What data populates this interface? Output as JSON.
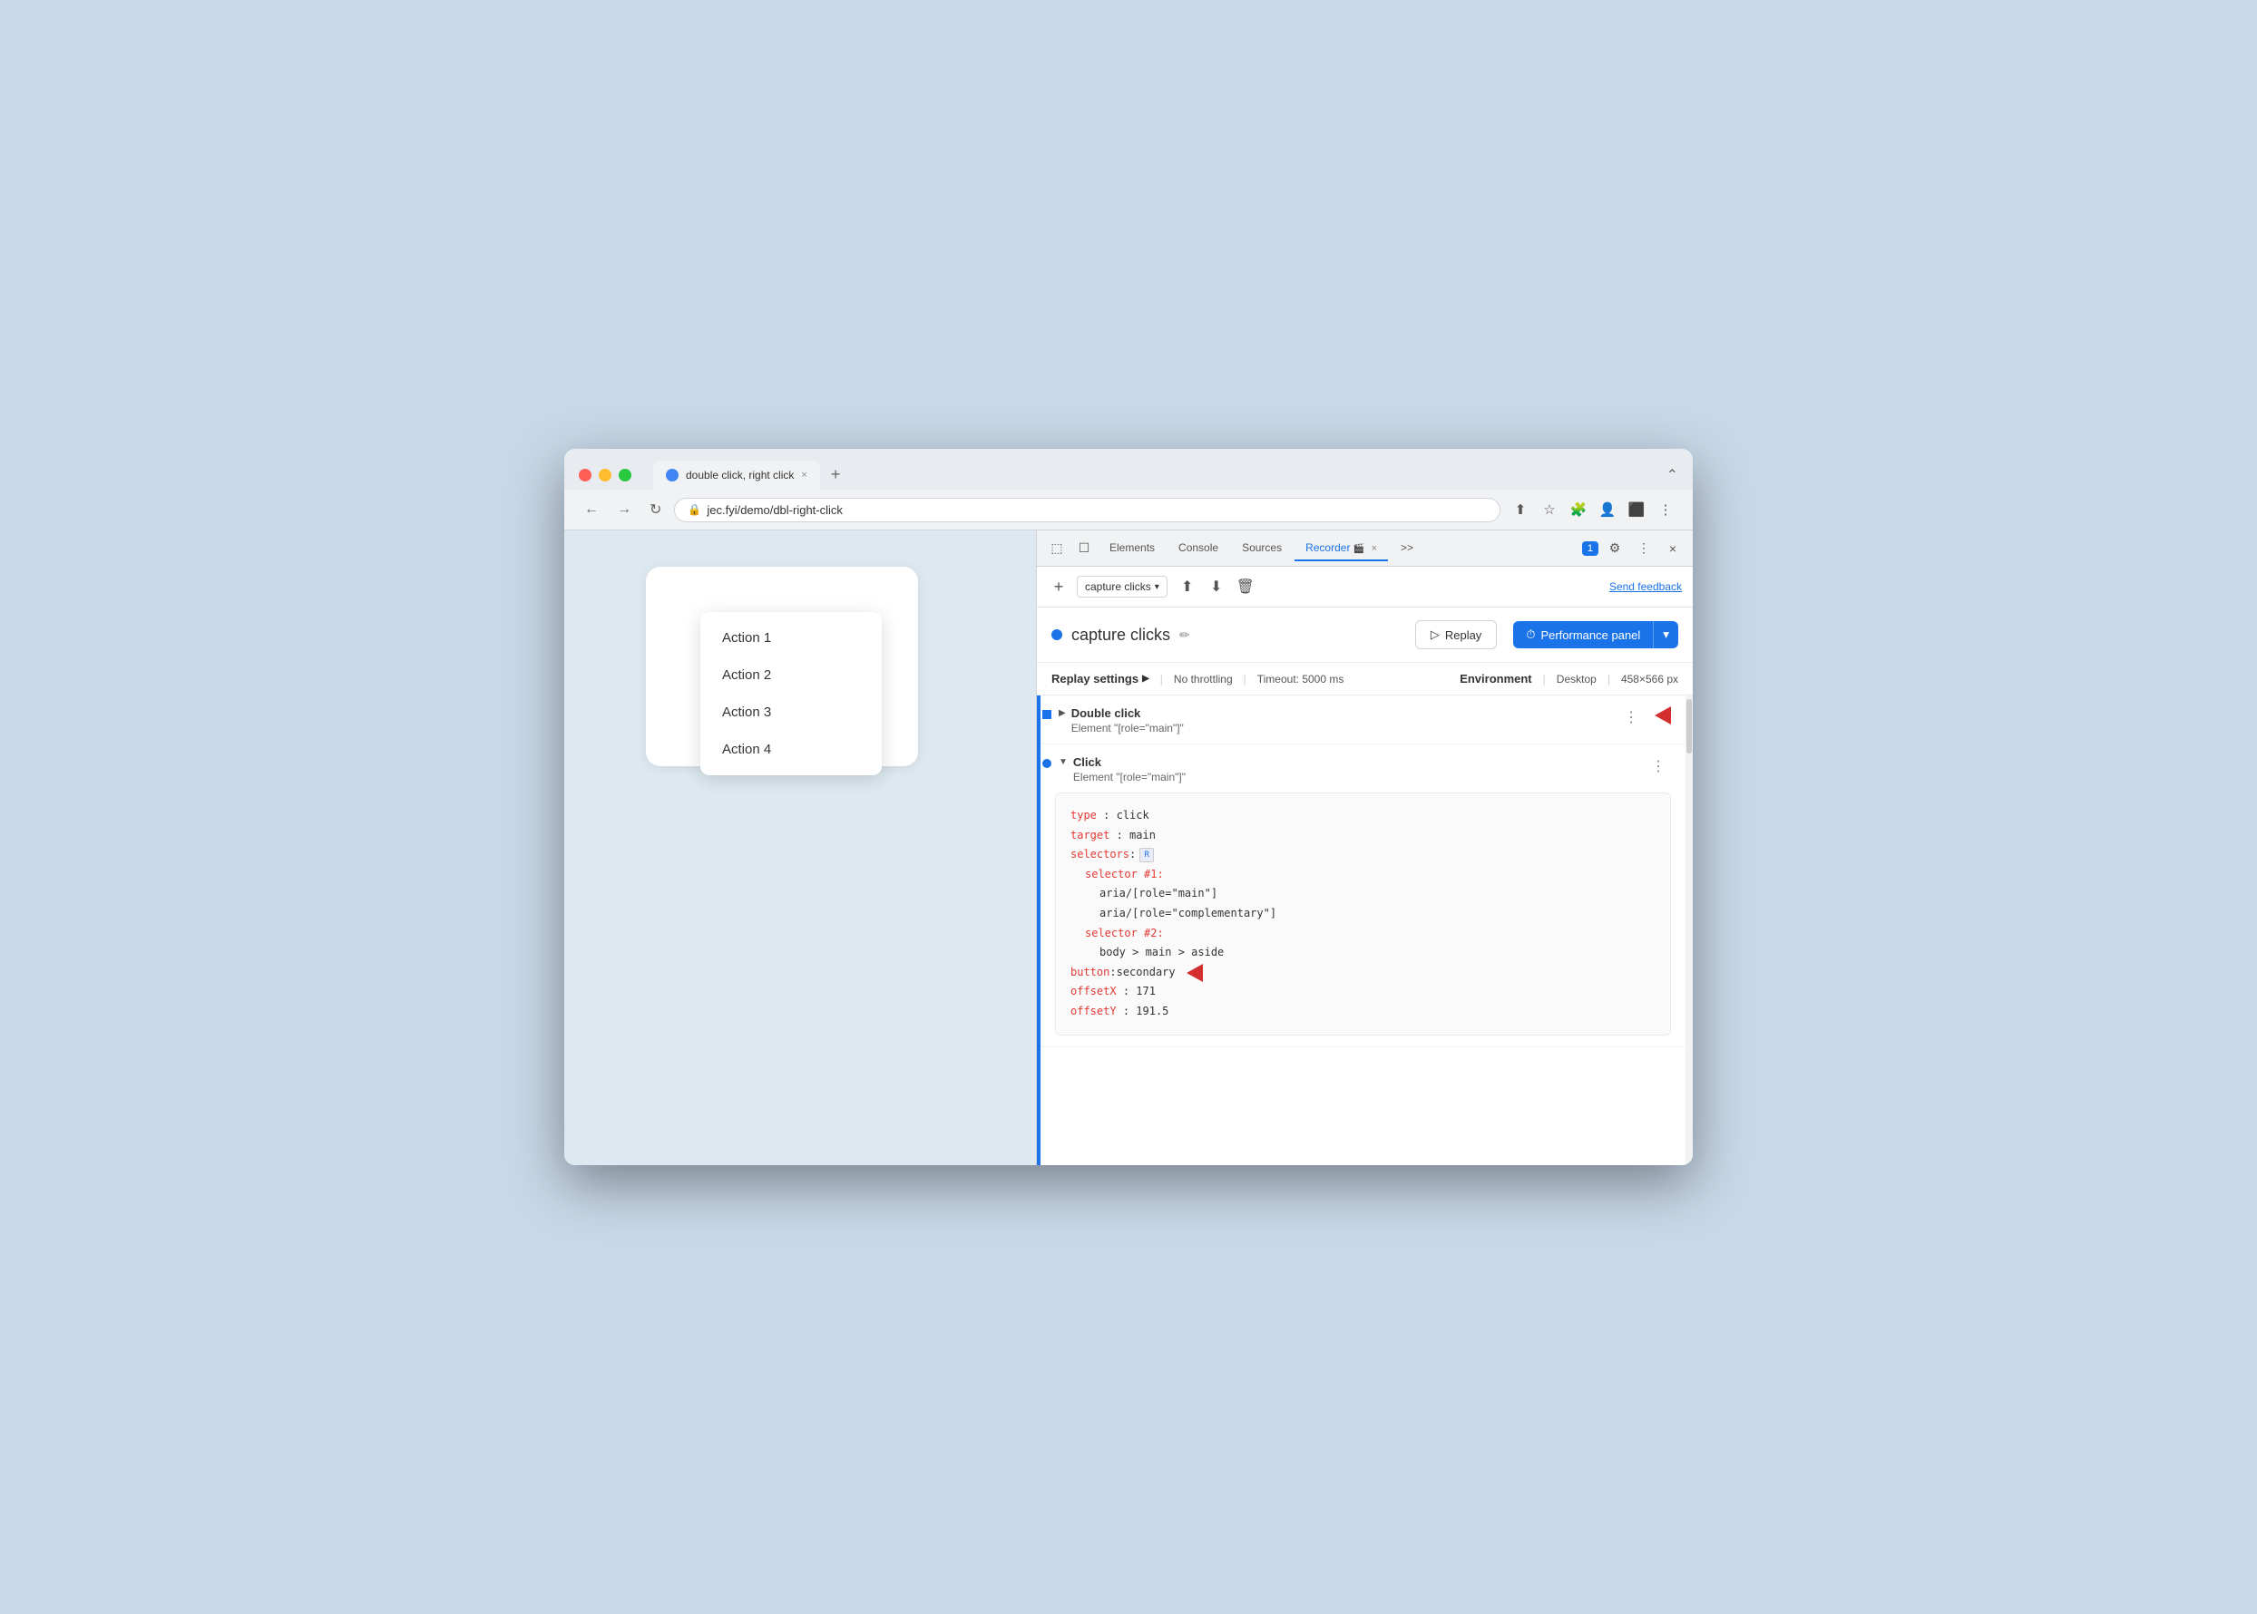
{
  "browser": {
    "tab_title": "double click, right click",
    "url": "jec.fyi/demo/dbl-right-click",
    "new_tab_icon": "+",
    "window_control": "⌃"
  },
  "devtools": {
    "tabs": [
      "Elements",
      "Console",
      "Sources",
      "Recorder",
      ">>"
    ],
    "active_tab": "Recorder",
    "close_label": "×",
    "badge": "1",
    "recording_name": "capture clicks",
    "recording_select_label": "capture clicks",
    "send_feedback": "Send feedback",
    "replay_btn": "Replay",
    "perf_btn": "Performance panel",
    "replay_settings_label": "Replay settings",
    "no_throttling": "No throttling",
    "timeout": "Timeout: 5000 ms",
    "environment_label": "Environment",
    "desktop": "Desktop",
    "resolution": "458×566 px"
  },
  "steps": [
    {
      "id": "step1",
      "collapsed": true,
      "title": "Double click",
      "subtitle": "Element \"[role=\"main\"]\"",
      "has_arrow": true
    },
    {
      "id": "step2",
      "collapsed": false,
      "title": "Click",
      "subtitle": "Element \"[role=\"main\"]\"",
      "has_arrow": false,
      "code": {
        "type_key": "type",
        "type_val": "click",
        "target_key": "target",
        "target_val": "main",
        "selectors_key": "selectors",
        "selector1_key": "selector #1:",
        "aria1": "aria/[role=\"main\"]",
        "aria2": "aria/[role=\"complementary\"]",
        "selector2_key": "selector #2:",
        "body_main": "body > main > aside",
        "button_key": "button",
        "button_val": "secondary",
        "offsetX_key": "offsetX",
        "offsetX_val": "171",
        "offsetY_key": "offsetY",
        "offsetY_val": "191.5"
      }
    }
  ],
  "webpage": {
    "action_main": "Action 4",
    "menu_items": [
      "Action 1",
      "Action 2",
      "Action 3",
      "Action 4"
    ]
  }
}
